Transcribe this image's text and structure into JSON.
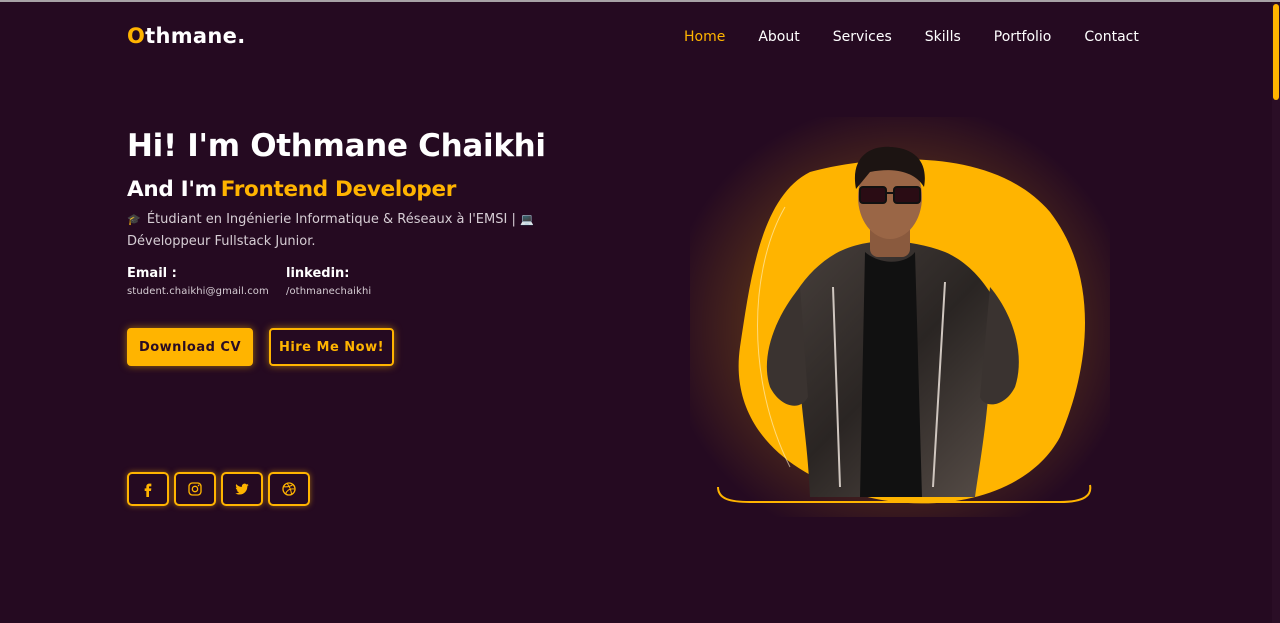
{
  "logo": {
    "first_letter": "O",
    "rest": "thmane."
  },
  "nav": {
    "items": [
      {
        "label": "Home",
        "active": true
      },
      {
        "label": "About"
      },
      {
        "label": "Services"
      },
      {
        "label": "Skills"
      },
      {
        "label": "Portfolio"
      },
      {
        "label": "Contact"
      }
    ]
  },
  "hero": {
    "title": "Hi! I'm Othmane Chaikhi",
    "subtitle_prefix": "And I'm",
    "role": "Frontend Developer",
    "description_line1": "Étudiant en Ingénierie Informatique & Réseaux à l'EMSI |",
    "description_line2": "Développeur Fullstack Junior.",
    "emoji_cap": "🎓",
    "emoji_laptop": "💻"
  },
  "contact": {
    "email_label": "Email :",
    "email_value": "student.chaikhi@gmail.com",
    "linkedin_label": "linkedin:",
    "linkedin_value": "/othmanechaikhi"
  },
  "buttons": {
    "download": "Download CV",
    "hire": "Hire Me Now!"
  },
  "social": [
    "facebook-icon",
    "instagram-icon",
    "twitter-icon",
    "dribbble-icon"
  ],
  "colors": {
    "accent": "#ffb400",
    "background": "#250a21"
  }
}
